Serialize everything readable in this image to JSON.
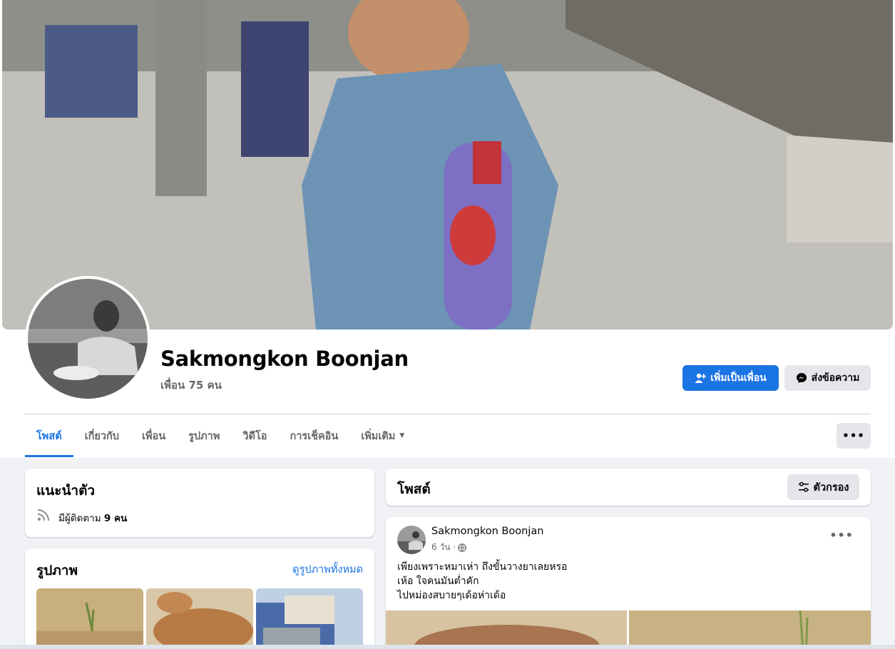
{
  "profile": {
    "name": "Sakmongkon Boonjan",
    "friends": "เพื่อน 75 คน"
  },
  "actions": {
    "add_friend": "เพิ่มเป็นเพื่อน",
    "message": "ส่งข้อความ",
    "more": "•••"
  },
  "tabs": [
    {
      "label": "โพสต์",
      "active": true
    },
    {
      "label": "เกี่ยวกับ"
    },
    {
      "label": "เพื่อน"
    },
    {
      "label": "รูปภาพ"
    },
    {
      "label": "วิดีโอ"
    },
    {
      "label": "การเช็คอิน"
    },
    {
      "label": "เพิ่มเติม"
    }
  ],
  "intro": {
    "title": "แนะนำตัว",
    "followers_prefix": "มีผู้ติดตาม",
    "followers_count": "9 คน"
  },
  "photos": {
    "title": "รูปภาพ",
    "see_all": "ดูรูปภาพทั้งหมด"
  },
  "posts": {
    "title": "โพสต์",
    "filter": "ตัวกรอง"
  },
  "post": {
    "author": "Sakmongkon Boonjan",
    "time": "6 วัน ·",
    "options": "•••",
    "lines": [
      "เพียงเพราะหมาเห่า ถึงขั้นวางยาเลยหรอ",
      "เห้อ ใจคนมันต่ำคัก",
      "ไปหม่องสบายๆเด้อห่าเด้อ"
    ]
  },
  "colors": {
    "accent": "#1b74e4",
    "background": "#f0f2f5",
    "secondary_text": "#65676b",
    "button_gray": "#e4e6eb"
  }
}
